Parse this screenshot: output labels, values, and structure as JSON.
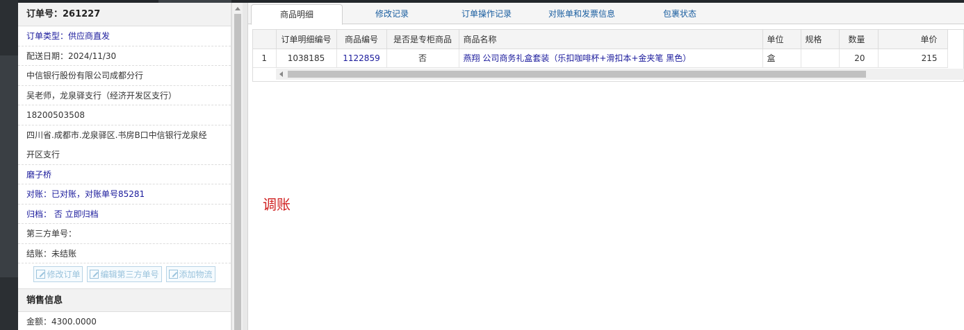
{
  "order": {
    "title": "订单号：261227",
    "rows": [
      "订单类型：供应商直发",
      "配送日期：2024/11/30",
      "中信银行股份有限公司成都分行",
      "吴老师，龙泉驿支行（经济开发区支行）",
      "18200503508"
    ],
    "address_line1": "四川省.成都市.龙泉驿区.书房B口中信银行龙泉经",
    "address_line2": "开区支行",
    "rows2": [
      "磨子桥",
      "对账：已对账，对账单号85281",
      "归档：  否 立即归档",
      "第三方单号：",
      "结账：未结账"
    ]
  },
  "buttons": {
    "edit_order": "修改订单",
    "edit_third_party": "编辑第三方单号",
    "add_logistics": "添加物流"
  },
  "sales": {
    "title": "销售信息",
    "amount": "金额：4300.0000"
  },
  "tabs": [
    "商品明细",
    "修改记录",
    "订单操作记录",
    "对账单和发票信息",
    "包裹状态"
  ],
  "table": {
    "headers": [
      "",
      "订单明细编号",
      "商品编号",
      "是否是专柜商品",
      "商品名称",
      "单位",
      "规格",
      "数量",
      "单价"
    ],
    "rows": [
      [
        "1",
        "1038185",
        "1122859",
        "否",
        "燕翔 公司商务礼盒套装（乐扣咖啡杯+滑扣本+金夹笔 黑色）",
        "盒",
        "",
        "20",
        "215"
      ]
    ]
  },
  "adjust_label": "调账",
  "colors": {
    "link": "#1a1a9c",
    "accent_red": "#d02020",
    "tab_text": "#1a5ea0"
  }
}
